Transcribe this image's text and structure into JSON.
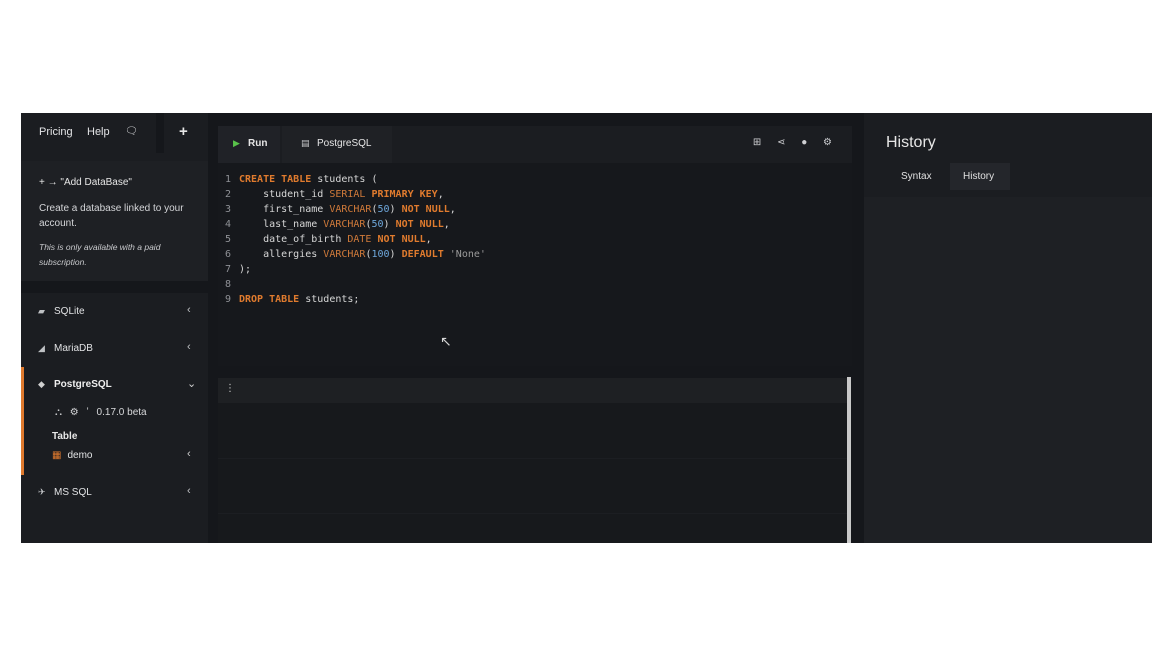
{
  "topbar": {
    "pricing": "Pricing",
    "help": "Help",
    "chat_icon": "chat-icon",
    "add_icon": "plus-icon"
  },
  "add_database": {
    "title": "+ → \"Add DataBase\"",
    "description": "Create a database linked to your account.",
    "note": "This is only available with a paid subscription."
  },
  "databases": {
    "sqlite": "SQLite",
    "mariadb": "MariaDB",
    "postgresql": "PostgreSQL",
    "mssql": "MS SQL"
  },
  "postgres_panel": {
    "version": "0.17.0 beta",
    "table_header": "Table",
    "table_name": "demo"
  },
  "editor": {
    "run_label": "Run",
    "engine_label": "PostgreSQL",
    "line_numbers": [
      "1",
      "2",
      "3",
      "4",
      "5",
      "6",
      "7",
      "8",
      "9"
    ]
  },
  "history": {
    "title": "History",
    "tabs": [
      "Syntax",
      "History"
    ],
    "active_tab": "History"
  },
  "colors": {
    "accent": "#e07a2e",
    "run_green": "#59c24a",
    "background": "#15171b"
  }
}
